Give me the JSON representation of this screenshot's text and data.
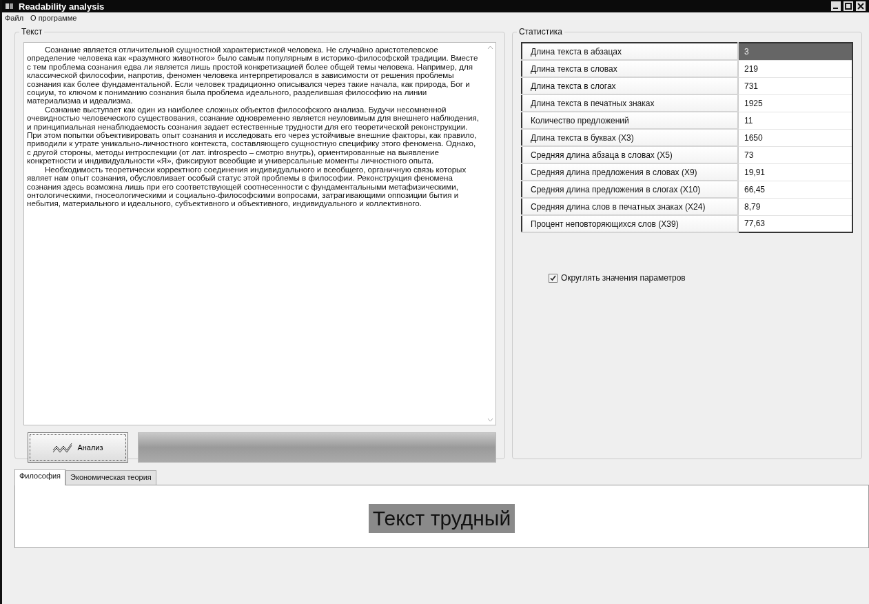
{
  "window": {
    "title": "Readability analysis"
  },
  "menu": [
    "Файл",
    "О программе"
  ],
  "text_group": {
    "title": "Текст",
    "paragraphs": [
      "Сознание является отличительной сущностной характеристикой человека. Не случайно аристотелевское определение человека как «разумного животного» было самым популярным в историко-философской традиции. Вместе с тем проблема сознания едва ли является лишь простой конкретизацией более общей темы человека. Например, для классической философии, напротив, феномен человека интерпретировался в зависимости от решения проблемы сознания как более фундаментальной. Если человек традиционно описывался через такие начала, как природа, Бог и социум, то ключом к пониманию сознания была проблема идеального, разделившая философию на линии материализма и идеализма.",
      "Сознание выступает как один из наиболее сложных объектов философского анализа. Будучи несомненной очевидностью человеческого существования, сознание одновременно является неуловимым для внешнего наблюдения, и принципиальная ненаблюдаемость сознания задает естественные трудности для его теоретической реконструкции. При этом попытки объективировать опыт сознания и исследовать его через устойчивые внешние факторы, как правило, приводили к утрате уникально-личностного контекста, составляющего сущностную специфику этого феномена. Однако, с другой стороны, методы интроспекции (от лат. introspecto – смотрю внутрь), ориентированные на выявление конкретности и индивидуальности «Я», фиксируют всеобщие и универсальные моменты личностного опыта.",
      "Необходимость теоретически корректного соединения индивидуального и всеобщего, органичную связь которых являет нам опыт сознания, обусловливает особый статус этой проблемы в философии. Реконструкция феномена сознания здесь возможна лишь при его соответствующей соотнесенности с фундаментальными метафизическими, онтологическими, гносеологическими и социально-философскими вопросами, затрагивающими оппозиции бытия и небытия, материального и идеального, субъективного и объективного, индивидуального и коллективного."
    ],
    "analyze_button": "Анализ",
    "progress": {
      "level": 1
    }
  },
  "stats_group": {
    "title": "Статистика",
    "rows": [
      {
        "label": "Длина текста в абзацах",
        "value": "3",
        "selected": true
      },
      {
        "label": "Длина текста в словах",
        "value": "219",
        "selected": false
      },
      {
        "label": "Длина текста в слогах",
        "value": "731",
        "selected": false
      },
      {
        "label": "Длина текста в печатных знаках",
        "value": "1925",
        "selected": false
      },
      {
        "label": "Количество предложений",
        "value": "11",
        "selected": false
      },
      {
        "label": "Длина текста в буквах (X3)",
        "value": "1650",
        "selected": false
      },
      {
        "label": "Средняя длина абзаца в словах (X5)",
        "value": "73",
        "selected": false
      },
      {
        "label": "Средняя длина предложения в словах (X9)",
        "value": "19,91",
        "selected": false
      },
      {
        "label": "Средняя длина предложения в слогах (X10)",
        "value": "66,45",
        "selected": false
      },
      {
        "label": "Средняя длина слов в печатных знаках (X24)",
        "value": "8,79",
        "selected": false
      },
      {
        "label": "Процент неповторяющихся слов (X39)",
        "value": "77,63",
        "selected": false
      }
    ],
    "round_checkbox": {
      "label": "Округлять значения параметров",
      "checked": true
    }
  },
  "result_tabs": {
    "tabs": [
      {
        "label": "Философия",
        "selected": true
      },
      {
        "label": "Экономическая теория",
        "selected": false
      }
    ],
    "result": "Текст трудный"
  }
}
